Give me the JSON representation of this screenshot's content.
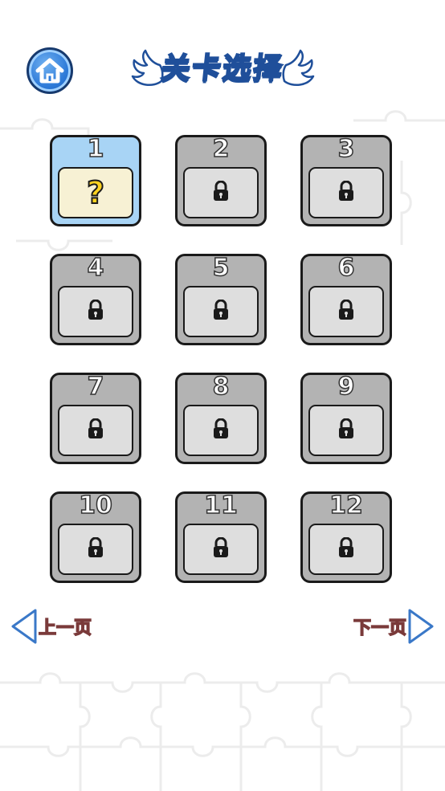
{
  "header": {
    "home_icon": "home-icon",
    "title": "关卡选择",
    "accent_color": "#2d7ad8"
  },
  "levels": [
    {
      "number": "1",
      "state": "unlocked",
      "icon": "question-mark-icon",
      "glyph": "?"
    },
    {
      "number": "2",
      "state": "locked",
      "icon": "lock-icon"
    },
    {
      "number": "3",
      "state": "locked",
      "icon": "lock-icon"
    },
    {
      "number": "4",
      "state": "locked",
      "icon": "lock-icon"
    },
    {
      "number": "5",
      "state": "locked",
      "icon": "lock-icon"
    },
    {
      "number": "6",
      "state": "locked",
      "icon": "lock-icon"
    },
    {
      "number": "7",
      "state": "locked",
      "icon": "lock-icon"
    },
    {
      "number": "8",
      "state": "locked",
      "icon": "lock-icon"
    },
    {
      "number": "9",
      "state": "locked",
      "icon": "lock-icon"
    },
    {
      "number": "10",
      "state": "locked",
      "icon": "lock-icon"
    },
    {
      "number": "11",
      "state": "locked",
      "icon": "lock-icon"
    },
    {
      "number": "12",
      "state": "locked",
      "icon": "lock-icon"
    }
  ],
  "pagination": {
    "prev_label": "上一页",
    "next_label": "下一页",
    "prev_icon": "triangle-left-icon",
    "next_icon": "triangle-right-icon"
  },
  "colors": {
    "unlocked_card": "#a8d4f5",
    "locked_card": "#b3b3b3",
    "question_mark": "#ffd21f"
  }
}
